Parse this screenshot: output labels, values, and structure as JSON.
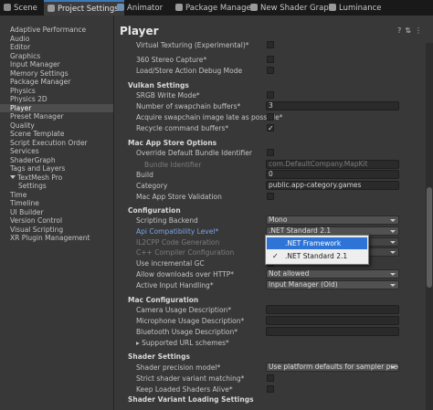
{
  "tabs": [
    {
      "label": "Scene",
      "icon": "scene-icon",
      "color": "#8a8a8a"
    },
    {
      "label": "Project Settings",
      "icon": "settings-gear-icon",
      "color": "#9a9a9a"
    },
    {
      "label": "Animator",
      "icon": "animator-icon",
      "color": "#6f8fb3"
    },
    {
      "label": "Package Manager",
      "icon": "package-icon",
      "color": "#9a9a9a"
    },
    {
      "label": "New Shader Graph",
      "icon": "shader-graph-icon",
      "color": "#9a9a9a"
    },
    {
      "label": "Luminance",
      "icon": "luminance-icon",
      "color": "#9a9a9a"
    }
  ],
  "sidebar": {
    "items": [
      {
        "label": "Adaptive Performance"
      },
      {
        "label": "Audio"
      },
      {
        "label": "Editor"
      },
      {
        "label": "Graphics"
      },
      {
        "label": "Input Manager"
      },
      {
        "label": "Memory Settings"
      },
      {
        "label": "Package Manager"
      },
      {
        "label": "Physics"
      },
      {
        "label": "Physics 2D"
      },
      {
        "label": "Player"
      },
      {
        "label": "Preset Manager"
      },
      {
        "label": "Quality"
      },
      {
        "label": "Scene Template"
      },
      {
        "label": "Script Execution Order"
      },
      {
        "label": "Services"
      },
      {
        "label": "ShaderGraph"
      },
      {
        "label": "Tags and Layers"
      },
      {
        "label": "TextMesh Pro"
      },
      {
        "label": "Settings"
      },
      {
        "label": "Time"
      },
      {
        "label": "Timeline"
      },
      {
        "label": "UI Builder"
      },
      {
        "label": "Version Control"
      },
      {
        "label": "Visual Scripting"
      },
      {
        "label": "XR Plugin Management"
      }
    ],
    "selected": "Player"
  },
  "main": {
    "title": "Player",
    "header_icons": [
      "help-icon",
      "preset-icon",
      "more-icon"
    ]
  },
  "rows": [
    {
      "label": "Virtual Texturing (Experimental)*",
      "control": "checkbox",
      "checked": false
    },
    {
      "label": "360 Stereo Capture*",
      "control": "checkbox",
      "checked": false
    },
    {
      "label": "Load/Store Action Debug Mode",
      "control": "checkbox",
      "checked": false
    },
    {
      "label": "Vulkan Settings",
      "control": "section"
    },
    {
      "label": "SRGB Write Mode*",
      "control": "checkbox",
      "checked": false
    },
    {
      "label": "Number of swapchain buffers*",
      "control": "field",
      "value": "3"
    },
    {
      "label": "Acquire swapchain image late as possible*",
      "control": "checkbox",
      "checked": false
    },
    {
      "label": "Recycle command buffers*",
      "control": "checkbox",
      "checked": true
    },
    {
      "label": "Mac App Store Options",
      "control": "section"
    },
    {
      "label": "Override Default Bundle Identifier",
      "control": "checkbox",
      "checked": false
    },
    {
      "label": "Bundle Identifier",
      "control": "field",
      "value": "com.DefaultCompany.MapKit",
      "disabled": true
    },
    {
      "label": "Build",
      "control": "field",
      "value": "0"
    },
    {
      "label": "Category",
      "control": "field",
      "value": "public.app-category.games"
    },
    {
      "label": "Mac App Store Validation",
      "control": "checkbox",
      "checked": false
    },
    {
      "label": "Configuration",
      "control": "section"
    },
    {
      "label": "Scripting Backend",
      "control": "dropdown",
      "value": "Mono"
    },
    {
      "label": "Api Compatibility Level*",
      "control": "dropdown",
      "value": ".NET Standard 2.1",
      "link": true
    },
    {
      "label": "IL2CPP Code Generation",
      "control": "dropdown",
      "value": "",
      "disabled": true
    },
    {
      "label": "C++ Compiler Configuration",
      "control": "dropdown",
      "value": "",
      "disabled": true
    },
    {
      "label": "Use incremental GC",
      "control": "checkbox",
      "checked": false
    },
    {
      "label": "Allow downloads over HTTP*",
      "control": "dropdown",
      "value": "Not allowed"
    },
    {
      "label": "Active Input Handling*",
      "control": "dropdown",
      "value": "Input Manager (Old)"
    },
    {
      "label": "Mac Configuration",
      "control": "section"
    },
    {
      "label": "Camera Usage Description*",
      "control": "field",
      "value": ""
    },
    {
      "label": "Microphone Usage Description*",
      "control": "field",
      "value": ""
    },
    {
      "label": "Bluetooth Usage Description*",
      "control": "field",
      "value": ""
    },
    {
      "label": "Supported URL schemes*",
      "control": "foldout"
    },
    {
      "label": "Shader Settings",
      "control": "section"
    },
    {
      "label": "Shader precision model*",
      "control": "dropdown",
      "value": "Use platform defaults for sampler precision"
    },
    {
      "label": "Strict shader variant matching*",
      "control": "checkbox",
      "checked": false
    },
    {
      "label": "Keep Loaded Shaders Alive*",
      "control": "checkbox",
      "checked": false
    },
    {
      "label": "Shader Variant Loading Settings",
      "control": "section"
    }
  ],
  "popup": {
    "options": [
      {
        "label": ".NET Framework",
        "checked": false,
        "highlighted": true
      },
      {
        "label": ".NET Standard 2.1",
        "checked": true,
        "highlighted": false
      }
    ],
    "check_glyph": "✓"
  },
  "colors": {
    "accent": "#3a79bb",
    "link": "#78a4e6",
    "highlight": "#2d74d6"
  }
}
